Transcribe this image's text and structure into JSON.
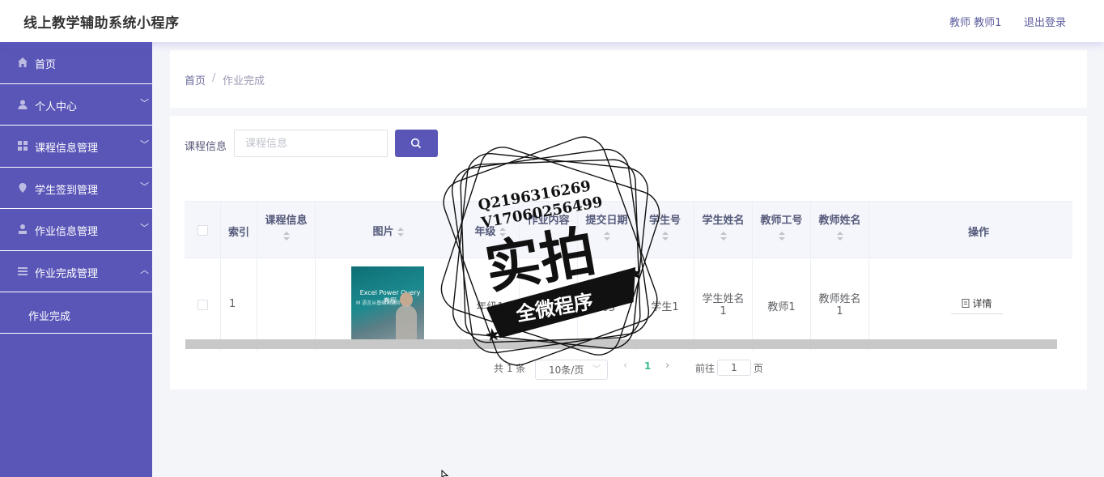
{
  "app": {
    "title": "线上教学辅助系统小程序",
    "user": "教师 教师1",
    "logout": "退出登录"
  },
  "sidebar": {
    "items": [
      {
        "label": "首页",
        "icon": "home-icon",
        "arrow": ""
      },
      {
        "label": "个人中心",
        "icon": "user-icon",
        "arrow": "﹀"
      },
      {
        "label": "课程信息管理",
        "icon": "grid-icon",
        "arrow": "﹀"
      },
      {
        "label": "学生签到管理",
        "icon": "location-icon",
        "arrow": "﹀"
      },
      {
        "label": "作业信息管理",
        "icon": "person-icon",
        "arrow": "﹀"
      },
      {
        "label": "作业完成管理",
        "icon": "menu-icon",
        "arrow": "︿"
      }
    ],
    "sub_items": [
      {
        "label": "作业完成"
      }
    ],
    "colors": {
      "background": "#5a56b8",
      "text": "#ffffff"
    }
  },
  "breadcrumb": {
    "home": "首页",
    "separator": "/",
    "current": "作业完成"
  },
  "search": {
    "label": "课程信息",
    "placeholder": "课程信息",
    "value": "",
    "button_icon": "search-icon"
  },
  "table": {
    "columns": [
      "索引",
      "课程信息",
      "图片",
      "年级",
      "作业内容",
      "提交日期",
      "学生号",
      "学生姓名",
      "教师工号",
      "教师姓名",
      "操作"
    ],
    "rows": [
      {
        "index": "1",
        "course": "",
        "image_text": [
          "Excel Power Query 教程",
          "M 语言从基础到进阶"
        ],
        "grade": "年级1",
        "content": "",
        "date_line1": "2024",
        "date_line2": "-05",
        "student_no": "学生1",
        "student_name_line1": "学生姓名",
        "student_name_line2": "1",
        "teacher_no": "教师1",
        "teacher_name_line1": "教师姓名",
        "teacher_name_line2": "1",
        "action": "详情"
      }
    ]
  },
  "pagination": {
    "total": "共 1 条",
    "page_size": "10条/页",
    "current_page": "1",
    "goto_label": "前往",
    "goto_value": "1",
    "page_suffix": "页"
  },
  "watermark": {
    "line1": "Q2196316269",
    "line2": "V17060256499",
    "main": "实拍",
    "ribbon": "全微程序"
  },
  "colors": {
    "accent": "#5a56b8",
    "page_number": "#3dbb8d",
    "background": "#f4f5f9"
  }
}
